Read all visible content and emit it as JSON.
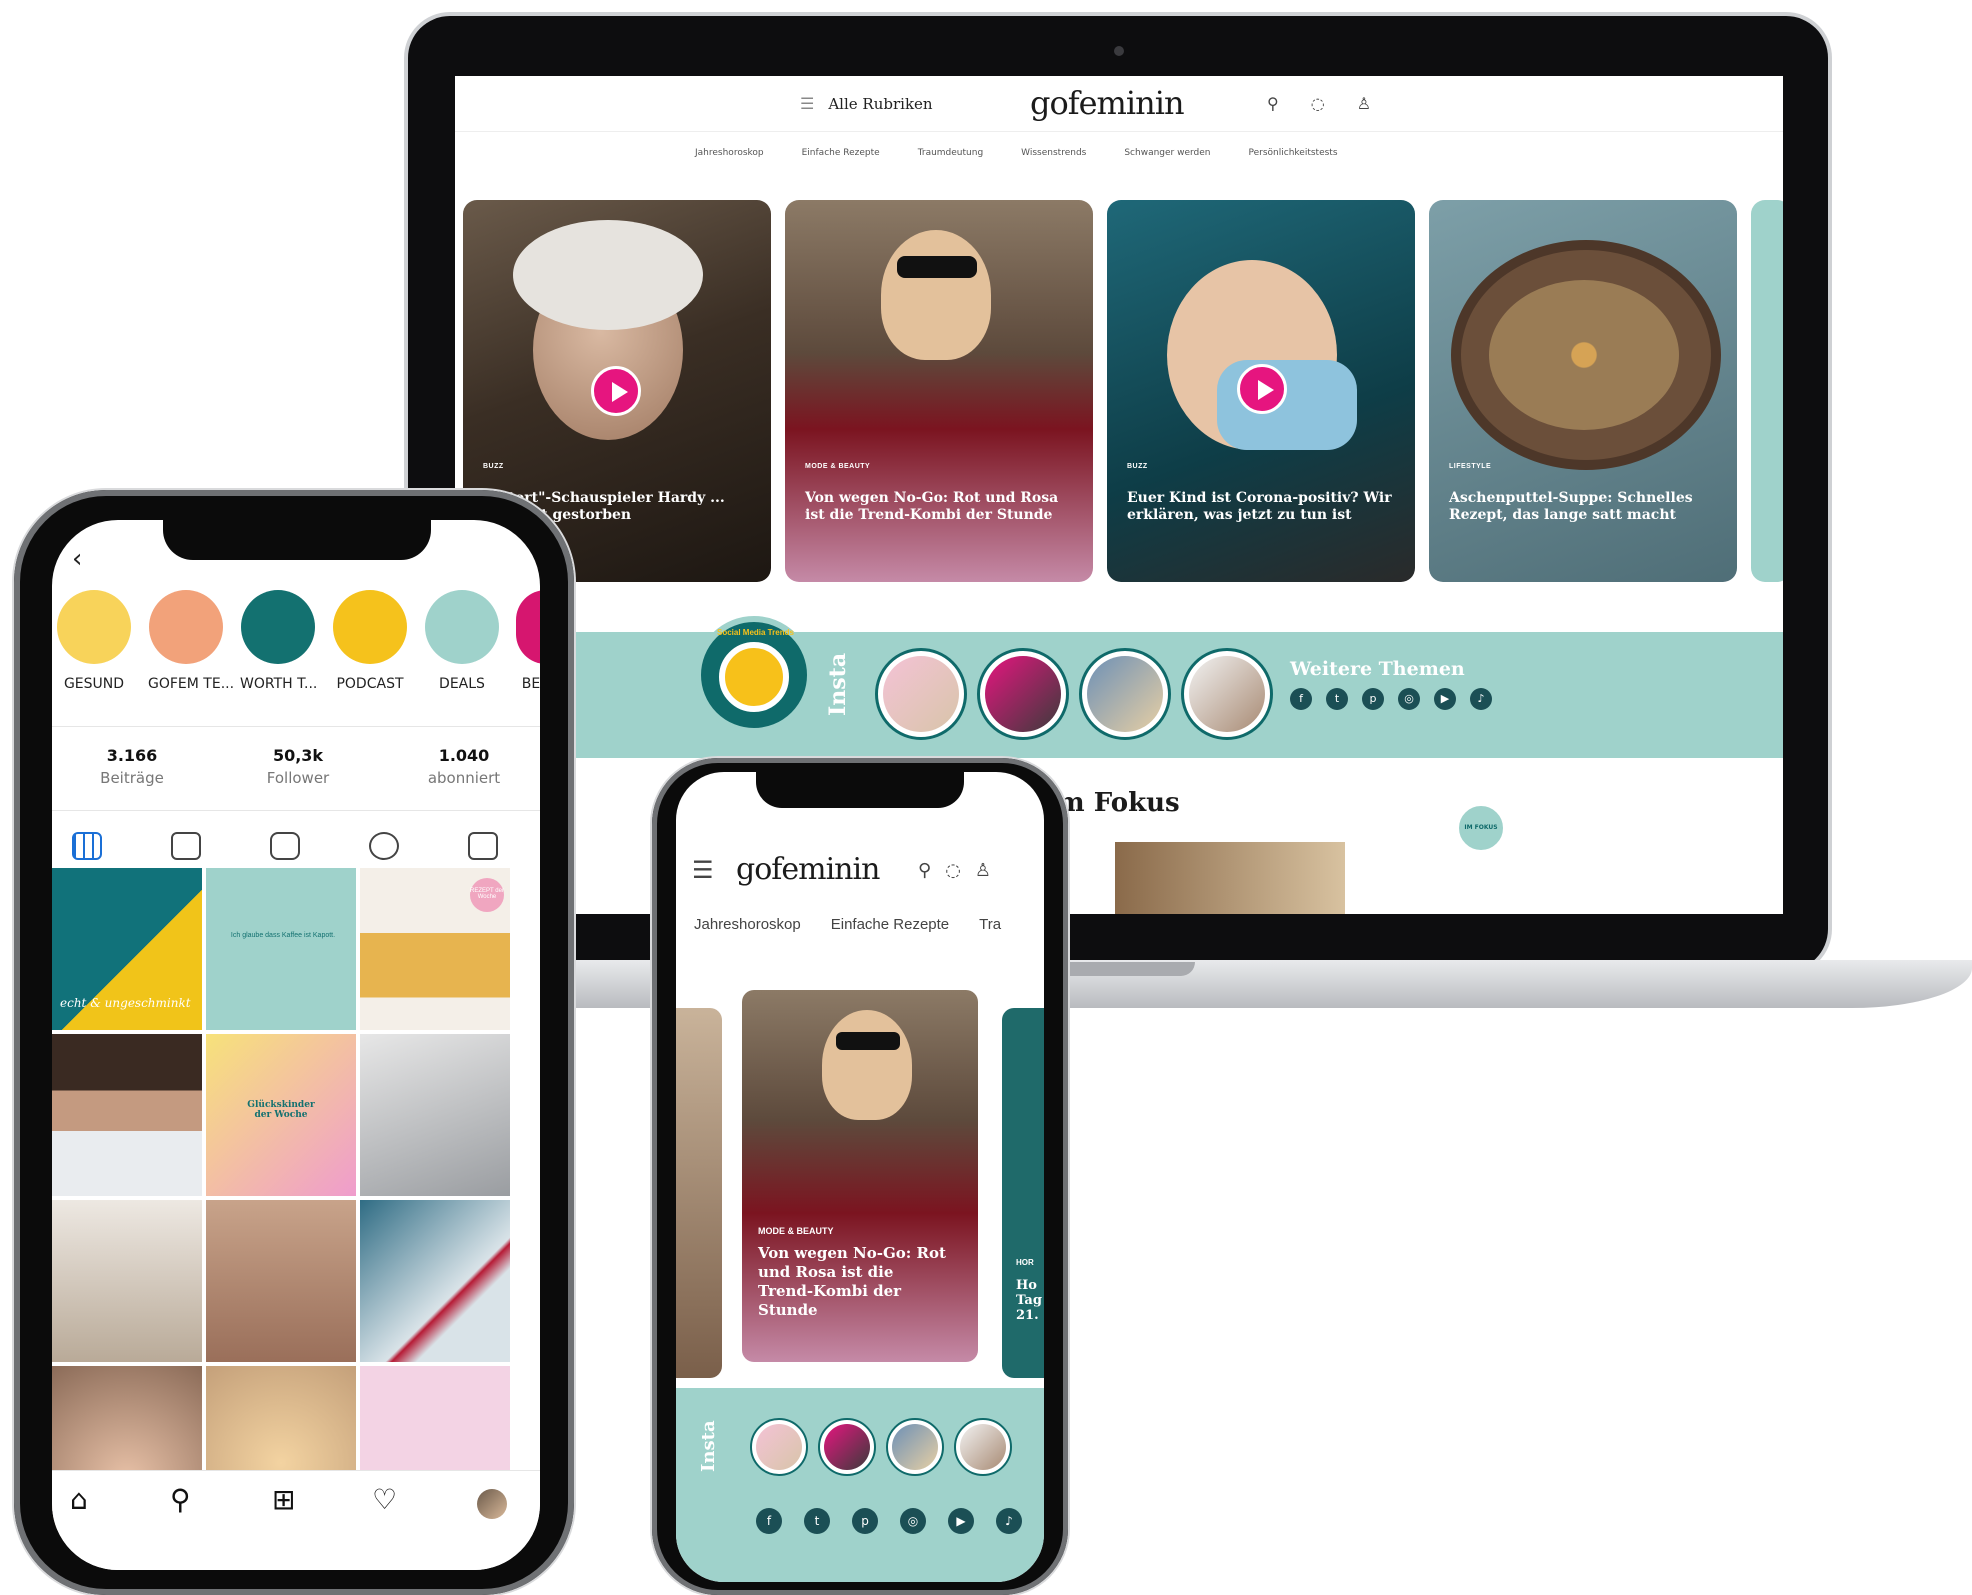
{
  "laptop": {
    "menu_label": "Alle Rubriken",
    "logo": "gofeminin",
    "nav": [
      "Jahreshoroskop",
      "Einfache Rezepte",
      "Traumdeutung",
      "Wissenstrends",
      "Schwanger werden",
      "Persönlichkeitstests"
    ],
    "cards": [
      {
        "category": "BUZZ",
        "title": "\"Tatort\"-Schauspieler Hardy ... (†93) ist gestorben",
        "has_video": true
      },
      {
        "category": "MODE & BEAUTY",
        "title": "Von wegen No-Go: Rot und Rosa ist die Trend-Kombi der Stunde",
        "has_video": false
      },
      {
        "category": "BUZZ",
        "title": "Euer Kind ist Corona-positiv? Wir erklären, was jetzt zu tun ist",
        "has_video": true
      },
      {
        "category": "LIFESTYLE",
        "title": "Aschenputtel-Suppe: Schnelles Rezept, das lange satt macht",
        "has_video": false
      }
    ],
    "social_badge": "Social Media Trends",
    "insta_label": "Insta",
    "weitere_themen": "Weitere Themen",
    "fokus_title": "Im Fokus",
    "fokus_badge": "IM FOKUS",
    "social_icons": [
      "facebook-icon",
      "twitter-icon",
      "pinterest-icon",
      "instagram-icon",
      "youtube-icon",
      "tiktok-icon"
    ],
    "accent": "#9fd2cb",
    "brand_pink": "#e6157f"
  },
  "instagram": {
    "highlights": [
      {
        "label": "GESUND",
        "color": "#f8d35a"
      },
      {
        "label": "GOFEM TE...",
        "color": "#f2a27a"
      },
      {
        "label": "WORTH T...",
        "color": "#137170"
      },
      {
        "label": "PODCAST",
        "color": "#f5c21c"
      },
      {
        "label": "DEALS",
        "color": "#9fd2cb"
      },
      {
        "label": "BE",
        "color": "#d6166f"
      }
    ],
    "stats": [
      {
        "value": "3.166",
        "label": "Beiträge"
      },
      {
        "value": "50,3k",
        "label": "Follower"
      },
      {
        "value": "1.040",
        "label": "abonniert"
      }
    ],
    "grid_text": {
      "tile1": "echt & ungeschminkt",
      "tile2": "Ich glaube dass Kaffee ist Kapott.",
      "tile3": "REZEPT der Woche",
      "tile5": "Glückskinder der Woche"
    }
  },
  "phone2": {
    "logo": "gofeminin",
    "nav": [
      "Jahreshoroskop",
      "Einfache Rezepte",
      "Tra"
    ],
    "card": {
      "category": "MODE & BEAUTY",
      "title": "Von wegen No-Go: Rot und Rosa ist die Trend-Kombi der Stunde"
    },
    "side_card_category": "HOR",
    "side_card_text": "Ho Tag 21.",
    "insta_label": "Insta"
  }
}
